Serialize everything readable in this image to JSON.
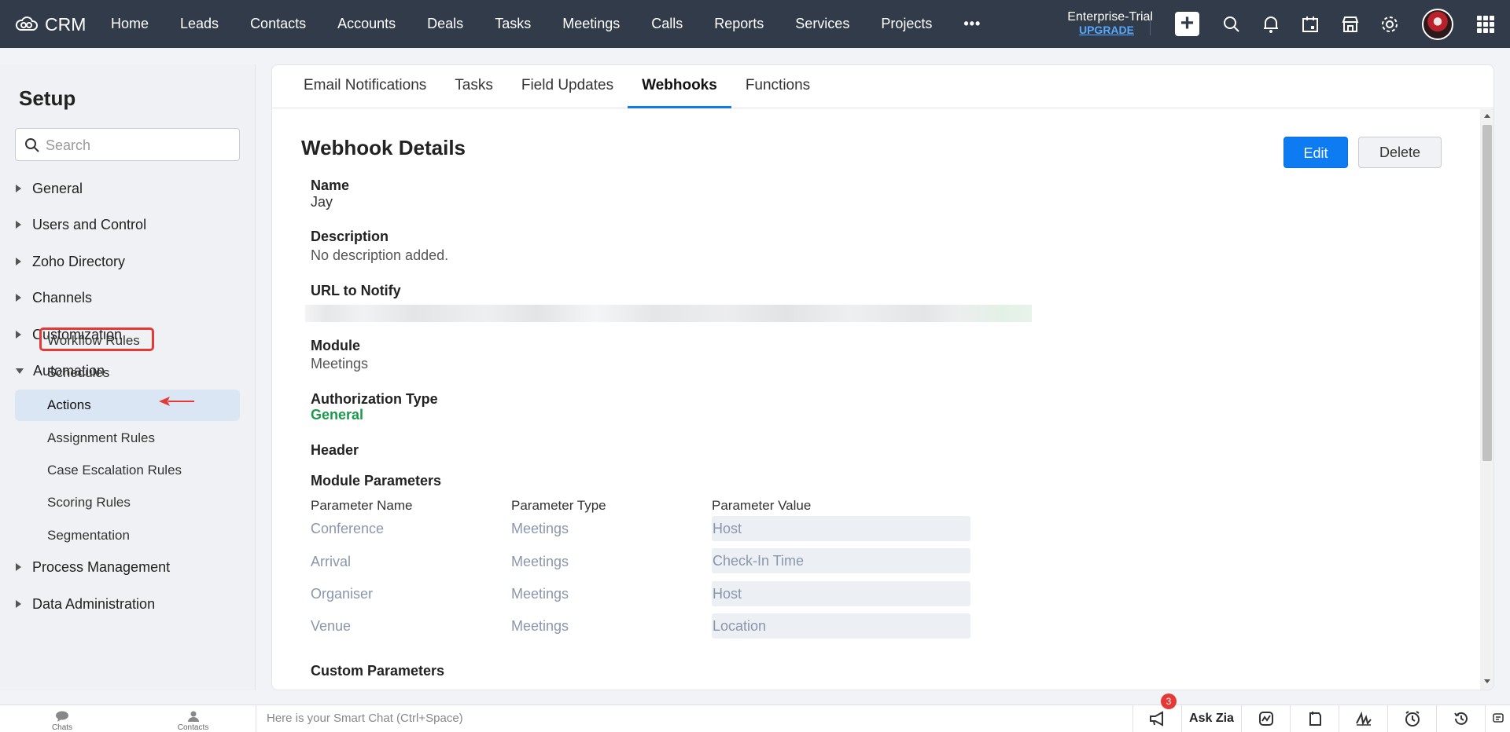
{
  "topbar": {
    "app_name": "CRM",
    "nav_items": [
      "Home",
      "Leads",
      "Contacts",
      "Accounts",
      "Deals",
      "Tasks",
      "Meetings",
      "Calls",
      "Reports",
      "Services",
      "Projects"
    ],
    "more": "•••",
    "plan": "Enterprise-Trial",
    "upgrade": "UPGRADE"
  },
  "sidebar": {
    "title": "Setup",
    "search_placeholder": "Search",
    "sections": {
      "general": "General",
      "users": "Users and Control",
      "zoho_directory": "Zoho Directory",
      "channels": "Channels",
      "customization": "Customization",
      "automation": "Automation",
      "process": "Process Management",
      "data_admin": "Data Administration"
    },
    "automation_items": {
      "workflow": "Workflow Rules",
      "schedules": "Schedules",
      "actions": "Actions",
      "assignment": "Assignment Rules",
      "case_escalation": "Case Escalation Rules",
      "scoring": "Scoring Rules",
      "segmentation": "Segmentation"
    }
  },
  "tabs": [
    "Email Notifications",
    "Tasks",
    "Field Updates",
    "Webhooks",
    "Functions"
  ],
  "webhook": {
    "title": "Webhook Details",
    "edit": "Edit",
    "delete": "Delete",
    "name_label": "Name",
    "name_value": "Jay",
    "desc_label": "Description",
    "desc_value": "No description added.",
    "url_label": "URL to Notify",
    "module_label": "Module",
    "module_value": "Meetings",
    "auth_label": "Authorization Type",
    "auth_value": "General",
    "header_label": "Header",
    "module_params_label": "Module Parameters",
    "param_headers": [
      "Parameter Name",
      "Parameter Type",
      "Parameter Value"
    ],
    "params": [
      {
        "name": "Conference",
        "type": "Meetings",
        "value": "Host"
      },
      {
        "name": "Arrival",
        "type": "Meetings",
        "value": "Check-In Time"
      },
      {
        "name": "Organiser",
        "type": "Meetings",
        "value": "Host"
      },
      {
        "name": "Venue",
        "type": "Meetings",
        "value": "Location"
      }
    ],
    "custom_params_label": "Custom Parameters"
  },
  "bottombar": {
    "chats": "Chats",
    "contacts": "Contacts",
    "smart_chat": "Here is your Smart Chat (Ctrl+Space)",
    "badge": "3",
    "ask_zia": "Ask Zia"
  },
  "colors": {
    "accent": "#0d7cf2",
    "topbar": "#323b4a",
    "highlight": "#e53935",
    "green": "#1a9a4b"
  }
}
